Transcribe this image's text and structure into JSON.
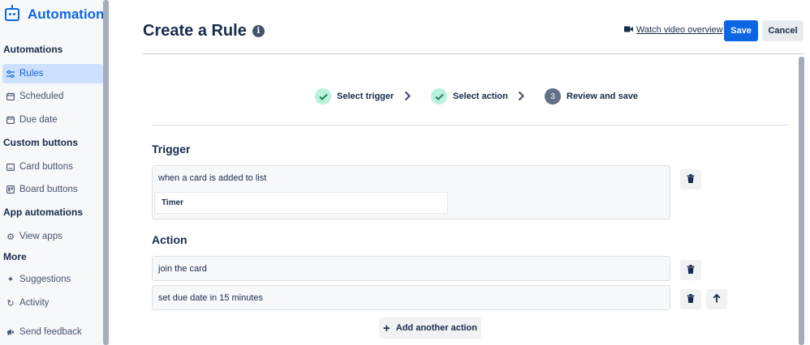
{
  "sidebar": {
    "brand_title": "Automation",
    "sections": {
      "automations": "Automations",
      "custom_buttons": "Custom buttons",
      "app_automations": "App automations",
      "more": "More"
    },
    "items": {
      "rules": "Rules",
      "scheduled": "Scheduled",
      "due_date": "Due date",
      "card_buttons": "Card buttons",
      "board_buttons": "Board buttons",
      "view_apps": "View apps",
      "suggestions": "Suggestions",
      "activity": "Activity",
      "send_feedback": "Send feedback"
    },
    "active_item": "rules"
  },
  "header": {
    "title": "Create a Rule",
    "watch_video_label": "Watch video overview",
    "save_label": "Save",
    "cancel_label": "Cancel"
  },
  "stepper": {
    "steps": [
      {
        "label": "Select trigger",
        "status": "done"
      },
      {
        "label": "Select action",
        "status": "done"
      },
      {
        "label": "Review and save",
        "status": "current",
        "number": "3"
      }
    ]
  },
  "trigger": {
    "title": "Trigger",
    "text": "when a card is added to list",
    "list_name": "Timer"
  },
  "action": {
    "title": "Action",
    "items": [
      {
        "text": "join the card"
      },
      {
        "text": "set due date in 15 minutes"
      }
    ],
    "add_label": "Add another action"
  },
  "colors": {
    "accent": "#0c66e4",
    "done_step": "#baf3db",
    "done_check": "#1f845a",
    "current_step": "#626f86"
  }
}
